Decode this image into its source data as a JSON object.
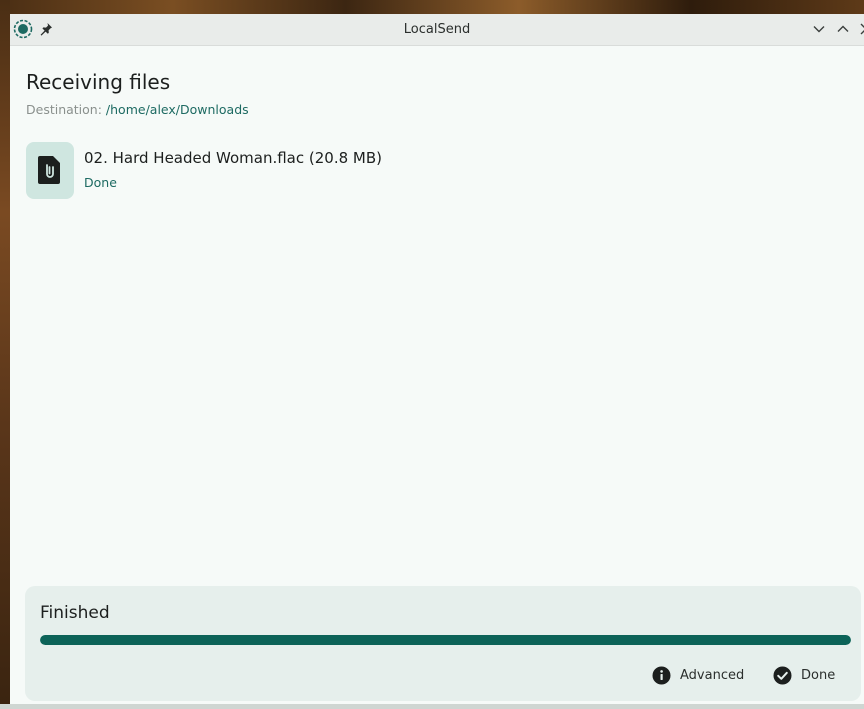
{
  "window": {
    "title": "LocalSend",
    "background_color": "#f6faf8",
    "accent_color": "#0c6358"
  },
  "titlebar": {
    "app_icon": "localsend-logo-icon",
    "pin_icon": "pin-icon",
    "minimize_icon": "chevron-down-icon",
    "maximize_icon": "chevron-up-icon",
    "close_icon": "close-icon"
  },
  "header": {
    "title": "Receiving files",
    "destination_label": "Destination: ",
    "destination_path": "/home/alex/Downloads"
  },
  "files": [
    {
      "icon": "file-attachment-icon",
      "name": "02. Hard Headed Woman.flac (20.8 MB)",
      "status": "Done"
    }
  ],
  "footer": {
    "status": "Finished",
    "progress": 1.0,
    "advanced_label": "Advanced",
    "advanced_icon": "info-icon",
    "done_label": "Done",
    "done_icon": "check-circle-icon"
  }
}
